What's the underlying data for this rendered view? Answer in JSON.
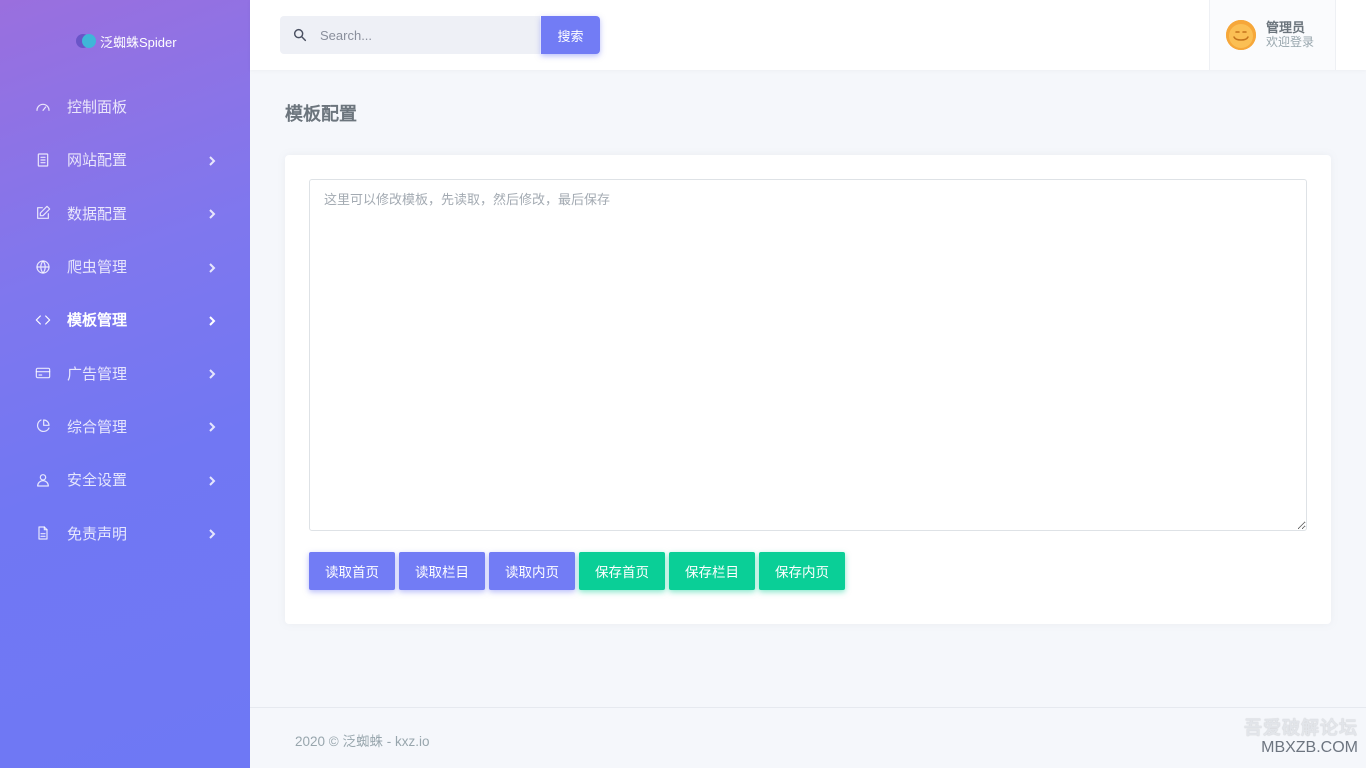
{
  "brand": {
    "name": "泛蜘蛛Spider"
  },
  "sidebar": {
    "items": [
      {
        "label": "控制面板",
        "icon": "dashboard-icon",
        "chevron": false
      },
      {
        "label": "网站配置",
        "icon": "document-icon",
        "chevron": true
      },
      {
        "label": "数据配置",
        "icon": "edit-icon",
        "chevron": true
      },
      {
        "label": "爬虫管理",
        "icon": "globe-icon",
        "chevron": true
      },
      {
        "label": "模板管理",
        "icon": "code-icon",
        "chevron": true,
        "active": true
      },
      {
        "label": "广告管理",
        "icon": "credit-card-icon",
        "chevron": true
      },
      {
        "label": "综合管理",
        "icon": "pie-chart-icon",
        "chevron": true
      },
      {
        "label": "安全设置",
        "icon": "user-icon",
        "chevron": true
      },
      {
        "label": "免责声明",
        "icon": "file-icon",
        "chevron": true
      }
    ]
  },
  "header": {
    "search_placeholder": "Search...",
    "search_button": "搜索",
    "user": {
      "name": "管理员",
      "subtitle": "欢迎登录"
    }
  },
  "main": {
    "title": "模板配置",
    "editor_placeholder": "这里可以修改模板，先读取，然后修改，最后保存",
    "buttons": [
      {
        "label": "读取首页",
        "style": "primary"
      },
      {
        "label": "读取栏目",
        "style": "primary"
      },
      {
        "label": "读取内页",
        "style": "primary"
      },
      {
        "label": "保存首页",
        "style": "success"
      },
      {
        "label": "保存栏目",
        "style": "success"
      },
      {
        "label": "保存内页",
        "style": "success"
      }
    ]
  },
  "footer": {
    "text": "2020 © 泛蜘蛛 - kxz.io"
  },
  "watermark": {
    "line1": "吾爱破解论坛",
    "line2": "MBXZB.COM"
  },
  "colors": {
    "primary": "#727cf5",
    "success": "#0acf97",
    "sidebar_start": "#9a6fde",
    "sidebar_end": "#6e78f5"
  }
}
